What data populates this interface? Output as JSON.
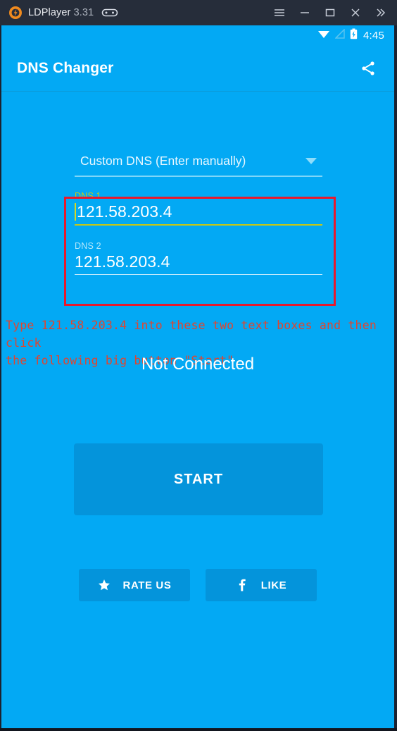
{
  "window": {
    "app_name": "LDPlayer",
    "version": "3.31",
    "icon": "ldplayer-logo-icon",
    "gamepad_icon": "gamepad-icon",
    "controls": [
      {
        "name": "menu-button",
        "icon": "hamburger-menu-icon"
      },
      {
        "name": "minimize-button",
        "icon": "minimize-icon"
      },
      {
        "name": "maximize-button",
        "icon": "maximize-icon"
      },
      {
        "name": "close-button",
        "icon": "close-icon"
      },
      {
        "name": "expand-button",
        "icon": "double-chevron-right-icon"
      }
    ]
  },
  "statusbar": {
    "wifi_icon": "wifi-icon",
    "signal_icon": "signal-none-icon",
    "battery_icon": "battery-charging-icon",
    "time": "4:45"
  },
  "appbar": {
    "title": "DNS Changer",
    "share_icon": "share-icon"
  },
  "main": {
    "dns_provider": {
      "selected": "Custom DNS (Enter manually)",
      "dropdown_icon": "chevron-down-icon"
    },
    "dns1": {
      "label": "DNS 1",
      "value": "121.58.203.4",
      "focused": true
    },
    "dns2": {
      "label": "DNS 2",
      "value": "121.58.203.4",
      "focused": false
    },
    "annotation": "Type 121.58.203.4 into these two text boxes and then click\nthe following big button \"Start\".",
    "status": "Not Connected",
    "start_label": "START",
    "rate_label": "RATE US",
    "rate_icon": "star-icon",
    "like_label": "LIKE",
    "like_icon": "facebook-icon"
  },
  "colors": {
    "app_blue": "#03a9f4",
    "button_blue": "#0494db",
    "annotation_red": "#e0452f",
    "highlight_box_red": "#e8192c",
    "focused_field_yellow": "#c8c814",
    "titlebar_dark": "#262d3a"
  }
}
